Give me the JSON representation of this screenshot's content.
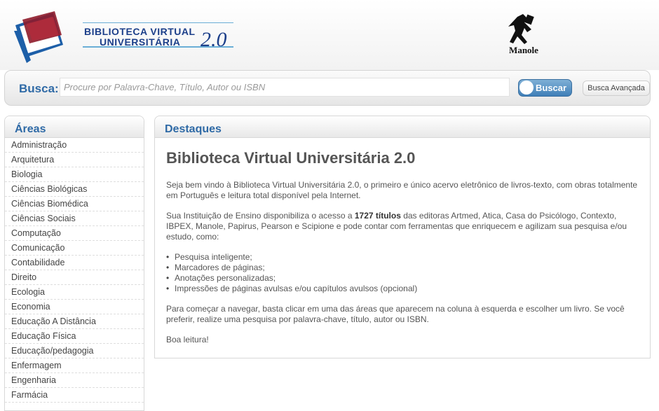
{
  "header": {
    "logo_line1": "BIBLIOTECA VIRTUAL",
    "logo_line2": "UNIVERSITÁRIA",
    "logo_version": "2.0",
    "publisher": "Manole"
  },
  "search": {
    "label": "Busca:",
    "placeholder": "Procure por Palavra-Chave, Título, Autor ou ISBN",
    "button": "Buscar",
    "advanced": "Busca Avançada"
  },
  "sidebar": {
    "title": "Áreas",
    "items": [
      "Administração",
      "Arquitetura",
      "Biologia",
      "Ciências Biológicas",
      "Ciências Biomédica",
      "Ciências Sociais",
      "Computação",
      "Comunicação",
      "Contabilidade",
      "Direito",
      "Ecologia",
      "Economia",
      "Educação A Distância",
      "Educação Física",
      "Educação/pedagogia",
      "Enfermagem",
      "Engenharia",
      "Farmácia"
    ]
  },
  "main": {
    "section_title": "Destaques",
    "heading": "Biblioteca Virtual Universitária 2.0",
    "intro": "Seja bem vindo à Biblioteca Virtual Universitária 2.0, o primeiro e único acervo eletrônico de livros-texto, com obras totalmente em Português e leitura total disponível pela Internet.",
    "p2_before": "Sua Instituição de Ensino disponibiliza o acesso a ",
    "p2_bold": "1727 títulos",
    "p2_after": " das editoras Artmed, Atica, Casa do Psicólogo, Contexto, IBPEX, Manole, Papirus, Pearson e Scipione e pode contar com ferramentas que enriquecem e agilizam sua pesquisa e/ou estudo, como:",
    "features": [
      "Pesquisa inteligente;",
      "Marcadores de páginas;",
      "Anotações personalizadas;",
      "Impressões de páginas avulsas e/ou capítulos avulsos (opcional)"
    ],
    "p3": "Para começar a navegar, basta clicar em uma das áreas que aparecem na coluna à esquerda e escolher um livro. Se você preferir, realize uma pesquisa por palavra-chave, título, autor ou ISBN.",
    "closing": "Boa leitura!"
  }
}
